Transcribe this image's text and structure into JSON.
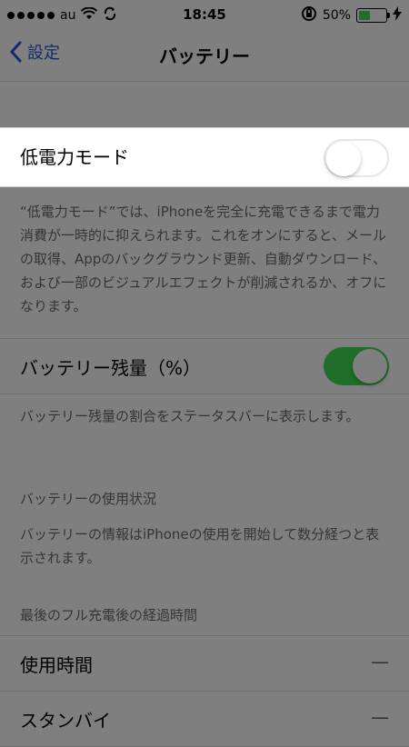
{
  "statusbar": {
    "carrier": "au",
    "time": "18:45",
    "battery": "50%",
    "battery_level": 0.5,
    "icons": [
      "signal-dots-icon",
      "wifi-icon",
      "sync-icon",
      "rotation-lock-icon",
      "charging-icon"
    ]
  },
  "nav": {
    "back_label": "設定",
    "title": "バッテリー"
  },
  "low_power": {
    "label": "低電力モード",
    "enabled": false,
    "description": "“低電力モード”では、iPhoneを完全に充電できるまで電力消費が一時的に抑えられます。これをオンにすると、メールの取得、Appのバックグラウンド更新、自動ダウンロード、および一部のビジュアルエフェクトが削減されるか、オフになります。"
  },
  "battery_percentage": {
    "label": "バッテリー残量（%）",
    "enabled": true,
    "description": "バッテリー残量の割合をステータスバーに表示します。"
  },
  "usage": {
    "header": "バッテリーの使用状況",
    "note": "バッテリーの情報はiPhoneの使用を開始して数分経つと表示されます。",
    "last_full_charge_header": "最後のフル充電後の経過時間",
    "rows": [
      {
        "label": "使用時間",
        "value": "—"
      },
      {
        "label": "スタンバイ",
        "value": "—"
      }
    ]
  },
  "colors": {
    "accent_green": "#1f6f2a",
    "dim_background": "#7f7f7f",
    "highlight_background": "#ffffff"
  }
}
